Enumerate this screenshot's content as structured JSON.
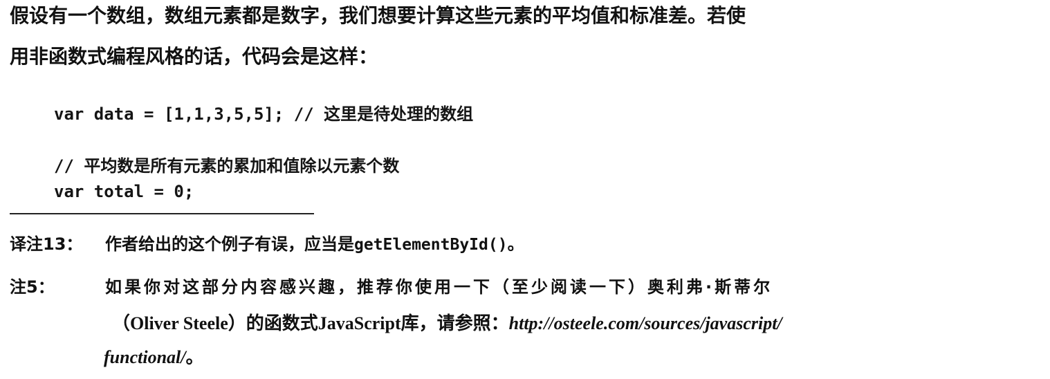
{
  "paragraph": {
    "line1": "假设有一个数组，数组元素都是数字，我们想要计算这些元素的平均值和标准差。若使",
    "line2": "用非函数式编程风格的话，代码会是这样："
  },
  "code": {
    "line1": "var data = [1,1,3,5,5]; // 这里是待处理的数组",
    "line2": "// 平均数是所有元素的累加和值除以元素个数",
    "line3": "var total = 0;"
  },
  "footnotes": {
    "note13": {
      "label": "译注13：",
      "text_before": "作者给出的这个例子有误，应当是",
      "code": "getElementById()",
      "text_after": "。"
    },
    "note5": {
      "label": "注5：",
      "line1": "如果你对这部分内容感兴趣，推荐你使用一下（至少阅读一下）奥利弗·斯蒂尔",
      "line2_text": "（Oliver Steele）的函数式JavaScript库，请参照：",
      "line2_url": "http://osteele.com/sources/javascript/",
      "line3_url": "functional/",
      "line3_text": "。"
    }
  }
}
